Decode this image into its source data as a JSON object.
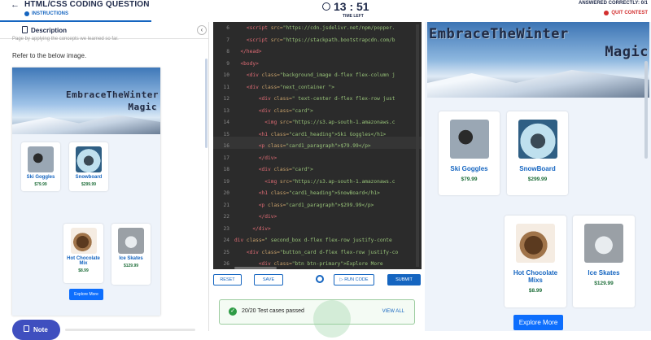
{
  "header": {
    "back": "←",
    "title": "HTML/CSS CODING QUESTION",
    "instructions": "INSTRUCTIONS",
    "timer": "13 : 51",
    "time_left": "TIME LEFT",
    "answered": "ANSWERED CORRECTLY: 0/1",
    "quit": "QUIT CONTEST"
  },
  "left_panel": {
    "tab_label": "Description",
    "collapse": "‹",
    "clipped_text": "Page by applying the concepts we learned so far.",
    "refer_text": "Refer to the below image.",
    "note_label": "Note"
  },
  "small_preview": {
    "banner_line1": "EmbraceTheWinter",
    "banner_line2": "Magic",
    "cards": [
      {
        "name": "Ski Goggles",
        "price": "$79.99"
      },
      {
        "name": "Snowboard",
        "price": "$299.99"
      },
      {
        "name": "Hot Chocolate Mix",
        "price": "$8.99"
      },
      {
        "name": "Ice Skates",
        "price": "$129.99"
      }
    ],
    "button": "Explore More"
  },
  "editor": {
    "lines": [
      {
        "n": "6",
        "indent": "    ",
        "tag": "<script",
        "attr": " src=",
        "str": "\"https://cdn.jsdelivr.net/npm/popper."
      },
      {
        "n": "7",
        "indent": "    ",
        "tag": "<script",
        "attr": " src=",
        "str": "\"https://stackpath.bootstrapcdn.com/b"
      },
      {
        "n": "8",
        "indent": "  ",
        "tag": "</head>",
        "attr": "",
        "str": ""
      },
      {
        "n": "9",
        "indent": "  ",
        "tag": "<body>",
        "attr": "",
        "str": ""
      },
      {
        "n": "10",
        "indent": "    ",
        "tag": "<div",
        "attr": " class=",
        "str": "\"background_image d-flex flex-column j"
      },
      {
        "n": "11",
        "indent": "    ",
        "tag": "<div",
        "attr": " class=",
        "str": "\"next_container \">"
      },
      {
        "n": "12",
        "indent": "        ",
        "tag": "<div",
        "attr": " class=",
        "str": "\" text-center d-flex flex-row just"
      },
      {
        "n": "13",
        "indent": "        ",
        "tag": "<div",
        "attr": " class=",
        "str": "\"card\">"
      },
      {
        "n": "14",
        "indent": "          ",
        "tag": "<img",
        "attr": " src=",
        "str": "\"https://s3.ap-south-1.amazonaws.c"
      },
      {
        "n": "15",
        "indent": "        ",
        "tag": "<h1",
        "attr": " class=",
        "str": "\"card1_heading\">Ski Goggles</h1>"
      },
      {
        "n": "16",
        "indent": "        ",
        "tag": "<p",
        "attr": " class=",
        "str": "\"card1_paragraph\">$79.99</p>"
      },
      {
        "n": "17",
        "indent": "        ",
        "tag": "</div>",
        "attr": "",
        "str": ""
      },
      {
        "n": "18",
        "indent": "        ",
        "tag": "<div",
        "attr": " class=",
        "str": "\"card\">"
      },
      {
        "n": "19",
        "indent": "          ",
        "tag": "<img",
        "attr": " src=",
        "str": "\"https://s3.ap-south-1.amazonaws.c"
      },
      {
        "n": "20",
        "indent": "        ",
        "tag": "<h1",
        "attr": " class=",
        "str": "\"card1_heading\">SnowBoard</h1>"
      },
      {
        "n": "21",
        "indent": "        ",
        "tag": "<p",
        "attr": " class=",
        "str": "\"card1_paragraph\">$299.99</p>"
      },
      {
        "n": "22",
        "indent": "        ",
        "tag": "</div>",
        "attr": "",
        "str": ""
      },
      {
        "n": "23",
        "indent": "      ",
        "tag": "</div>",
        "attr": "",
        "str": ""
      },
      {
        "n": "24",
        "indent": "",
        "tag": "div",
        "attr": " class=",
        "str": "\" second_box d-flex flex-row justify-conte"
      },
      {
        "n": "25",
        "indent": "    ",
        "tag": "<div",
        "attr": " class=",
        "str": "\"button_card d-flex flex-row justify-co"
      },
      {
        "n": "26",
        "indent": "        ",
        "tag": "<div",
        "attr": " class=",
        "str": "\"btn btn-primary\">Explore More"
      }
    ]
  },
  "controls": {
    "reset": "RESET",
    "save": "SAVE",
    "run": "▷ RUN CODE",
    "submit": "SUBMIT",
    "check": "✓",
    "result": "20/20 Test cases passed",
    "view_all": "VIEW ALL"
  },
  "right_preview": {
    "banner_line1": "EmbraceTheWinter",
    "banner_line2": "Magic",
    "cards": [
      {
        "name": "Ski Goggles",
        "price": "$79.99"
      },
      {
        "name": "SnowBoard",
        "price": "$299.99"
      },
      {
        "name": "Hot Chocolate Mixs",
        "price": "$8.99"
      },
      {
        "name": "Ice Skates",
        "price": "$129.99"
      }
    ],
    "button": "Explore More"
  }
}
